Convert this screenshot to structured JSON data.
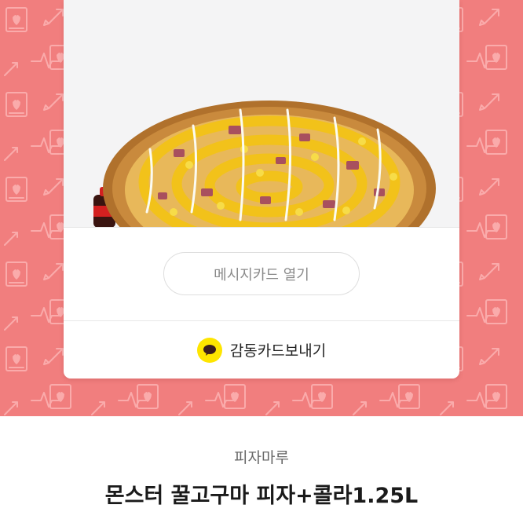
{
  "card": {
    "message_button_label": "메시지카드 열기",
    "send_label": "감동카드보내기"
  },
  "product": {
    "shop_name": "피자마루",
    "title": "몬스터 꿀고구마 피자+콜라1.25L"
  },
  "colors": {
    "background_pattern": "#f17e7e",
    "kakao_yellow": "#fee500",
    "card_image_bg": "#f4f4f5"
  },
  "icons": {
    "pattern": [
      "heart-card-icon",
      "arrow-icon",
      "heartbeat-icon"
    ],
    "send": "kakao-talk-icon"
  }
}
